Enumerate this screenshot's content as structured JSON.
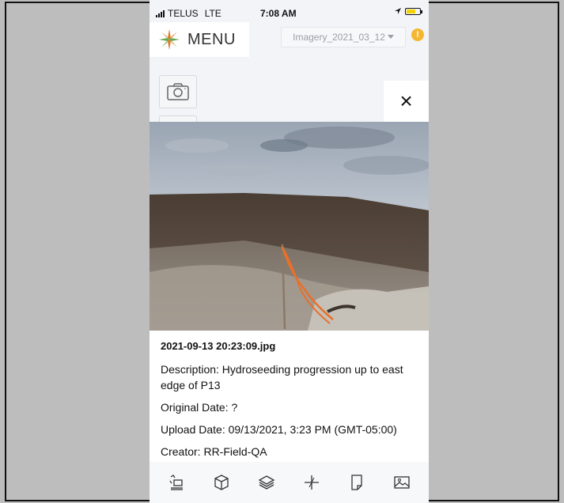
{
  "status_bar": {
    "carrier": "TELUS",
    "network": "LTE",
    "time": "7:08 AM"
  },
  "header": {
    "menu_label": "MENU",
    "imagery_select": "Imagery_2021_03_12",
    "warning_badge": "!"
  },
  "icons": {
    "logo": "compass-star-logo",
    "camera": "camera-icon",
    "close": "close-icon",
    "toolbar": [
      "measure-tool-icon",
      "3d-box-icon",
      "layers-icon",
      "crosshair-icon",
      "note-icon",
      "image-gallery-icon"
    ]
  },
  "close_symbol": "×",
  "photo": {
    "filename": "2021-09-13 20:23:09.jpg",
    "description": "Description: Hydroseeding progression up to east edge of P13",
    "original_date": "Original Date: ?",
    "upload_date": "Upload Date: 09/13/2021, 3:23 PM (GMT-05:00)",
    "creator": "Creator: RR-Field-QA"
  },
  "colors": {
    "warning": "#f5b731",
    "marker_tape": "#e8702a",
    "logo_orange": "#e0782a",
    "logo_green": "#6aa84f"
  }
}
